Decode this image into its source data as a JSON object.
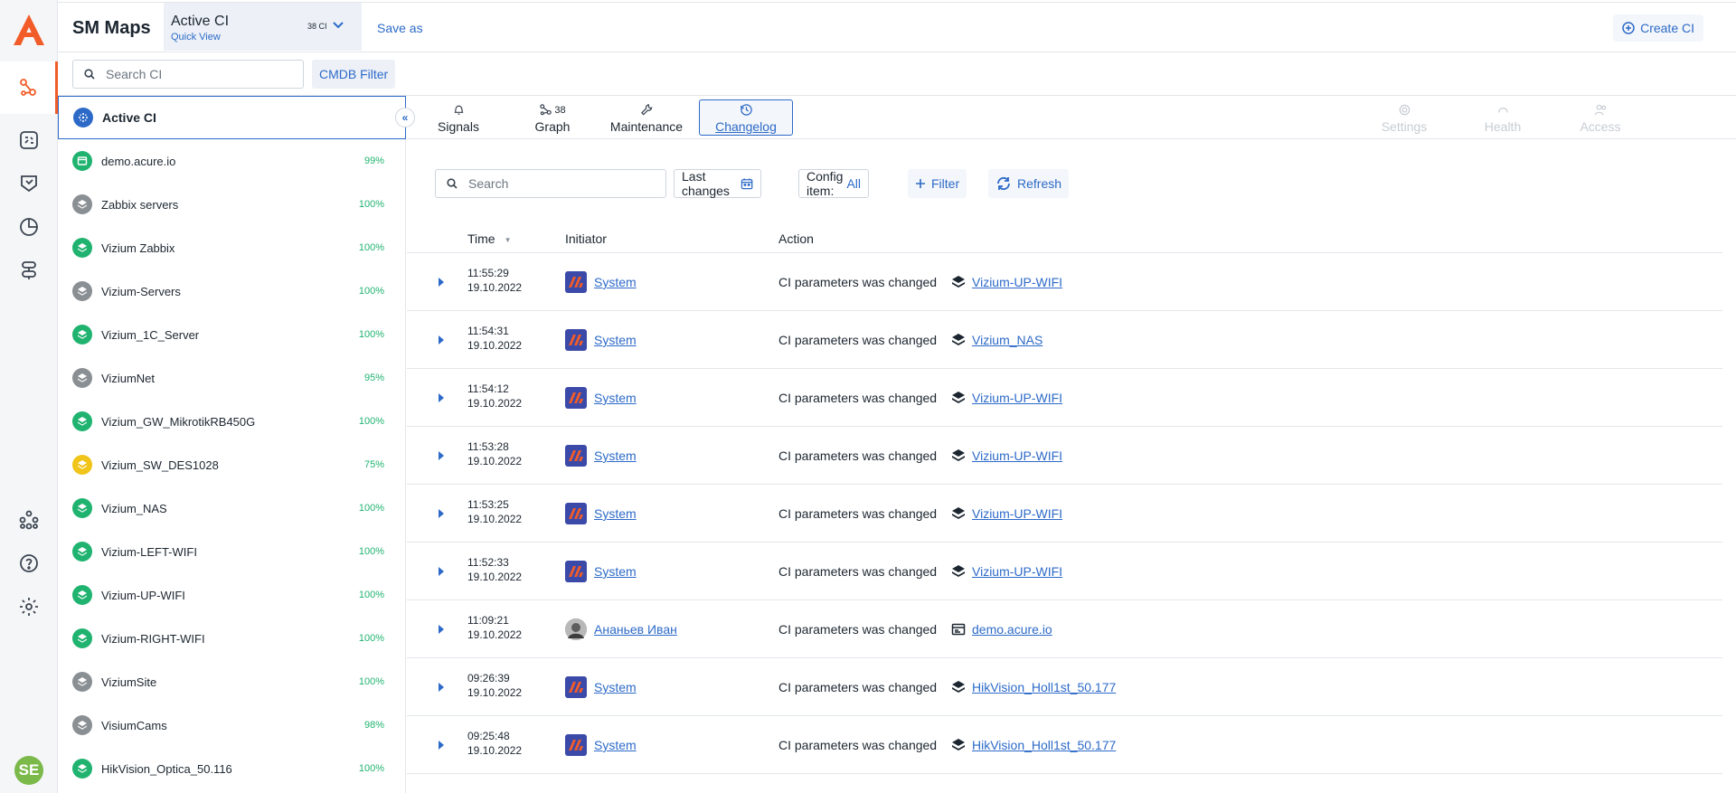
{
  "app": {
    "title": "SM Maps"
  },
  "view": {
    "name": "Active CI",
    "subtitle": "Quick View",
    "count": "38 CI"
  },
  "header": {
    "save_as": "Save as",
    "create_ci": "Create CI"
  },
  "search": {
    "placeholder": "Search CI",
    "cmdb_filter": "CMDB Filter"
  },
  "sidebar": {
    "items": [
      {
        "label": "Active CI",
        "pct": "",
        "color": "#2d6ac8",
        "active": true
      },
      {
        "label": "demo.acure.io",
        "pct": "99%",
        "color": "#20b370"
      },
      {
        "label": "Zabbix servers",
        "pct": "100%",
        "color": "#8a8f94"
      },
      {
        "label": "Vizium Zabbix",
        "pct": "100%",
        "color": "#20b370"
      },
      {
        "label": "Vizium-Servers",
        "pct": "100%",
        "color": "#8a8f94"
      },
      {
        "label": "Vizium_1C_Server",
        "pct": "100%",
        "color": "#20b370"
      },
      {
        "label": "ViziumNet",
        "pct": "95%",
        "color": "#8a8f94"
      },
      {
        "label": "Vizium_GW_MikrotikRB450G",
        "pct": "100%",
        "color": "#20b370"
      },
      {
        "label": "Vizium_SW_DES1028",
        "pct": "75%",
        "color": "#f0c419"
      },
      {
        "label": "Vizium_NAS",
        "pct": "100%",
        "color": "#20b370"
      },
      {
        "label": "Vizium-LEFT-WIFI",
        "pct": "100%",
        "color": "#20b370"
      },
      {
        "label": "Vizium-UP-WIFI",
        "pct": "100%",
        "color": "#20b370"
      },
      {
        "label": "Vizium-RIGHT-WIFI",
        "pct": "100%",
        "color": "#20b370"
      },
      {
        "label": "ViziumSite",
        "pct": "100%",
        "color": "#8a8f94"
      },
      {
        "label": "VisiumCams",
        "pct": "98%",
        "color": "#8a8f94"
      },
      {
        "label": "HikVision_Optica_50.116",
        "pct": "100%",
        "color": "#20b370"
      }
    ]
  },
  "tabs": [
    {
      "label": "Signals",
      "icon": "bell-icon",
      "badge": ""
    },
    {
      "label": "Graph",
      "icon": "graph-icon",
      "badge": "38"
    },
    {
      "label": "Maintenance",
      "icon": "wrench-icon",
      "badge": ""
    },
    {
      "label": "Changelog",
      "icon": "history-icon",
      "badge": "",
      "active": true
    },
    {
      "label": "Settings",
      "icon": "gear-icon",
      "badge": "",
      "disabled": true
    },
    {
      "label": "Health",
      "icon": "health-icon",
      "badge": "",
      "disabled": true
    },
    {
      "label": "Access",
      "icon": "users-icon",
      "badge": "",
      "disabled": true
    }
  ],
  "toolbar": {
    "search_placeholder": "Search",
    "last_changes": "Last changes",
    "config_item_label": "Config item:",
    "config_item_value": "All",
    "filter": "Filter",
    "refresh": "Refresh"
  },
  "table": {
    "headers": {
      "time": "Time",
      "initiator": "Initiator",
      "action": "Action"
    },
    "rows": [
      {
        "time": "11:55:29",
        "date": "19.10.2022",
        "initiator": "System",
        "initiator_type": "system",
        "action": "CI parameters was changed",
        "ci": "Vizium-UP-WIFI",
        "ci_icon": "layers-icon"
      },
      {
        "time": "11:54:31",
        "date": "19.10.2022",
        "initiator": "System",
        "initiator_type": "system",
        "action": "CI parameters was changed",
        "ci": "Vizium_NAS",
        "ci_icon": "layers-icon"
      },
      {
        "time": "11:54:12",
        "date": "19.10.2022",
        "initiator": "System",
        "initiator_type": "system",
        "action": "CI parameters was changed",
        "ci": "Vizium-UP-WIFI",
        "ci_icon": "layers-icon"
      },
      {
        "time": "11:53:28",
        "date": "19.10.2022",
        "initiator": "System",
        "initiator_type": "system",
        "action": "CI parameters was changed",
        "ci": "Vizium-UP-WIFI",
        "ci_icon": "layers-icon"
      },
      {
        "time": "11:53:25",
        "date": "19.10.2022",
        "initiator": "System",
        "initiator_type": "system",
        "action": "CI parameters was changed",
        "ci": "Vizium-UP-WIFI",
        "ci_icon": "layers-icon"
      },
      {
        "time": "11:52:33",
        "date": "19.10.2022",
        "initiator": "System",
        "initiator_type": "system",
        "action": "CI parameters was changed",
        "ci": "Vizium-UP-WIFI",
        "ci_icon": "layers-icon"
      },
      {
        "time": "11:09:21",
        "date": "19.10.2022",
        "initiator": "Ананьев Иван",
        "initiator_type": "user",
        "action": "CI parameters was changed",
        "ci": "demo.acure.io",
        "ci_icon": "window-icon"
      },
      {
        "time": "09:26:39",
        "date": "19.10.2022",
        "initiator": "System",
        "initiator_type": "system",
        "action": "CI parameters was changed",
        "ci": "HikVision_Holl1st_50.177",
        "ci_icon": "layers-icon"
      },
      {
        "time": "09:25:48",
        "date": "19.10.2022",
        "initiator": "System",
        "initiator_type": "system",
        "action": "CI parameters was changed",
        "ci": "HikVision_Holl1st_50.177",
        "ci_icon": "layers-icon"
      }
    ]
  },
  "user": {
    "initials": "SE"
  },
  "colors": {
    "accent": "#2d6ac8",
    "brand": "#f25c28",
    "ok": "#20b370",
    "warn": "#f0c419",
    "neutral": "#8a8f94"
  }
}
